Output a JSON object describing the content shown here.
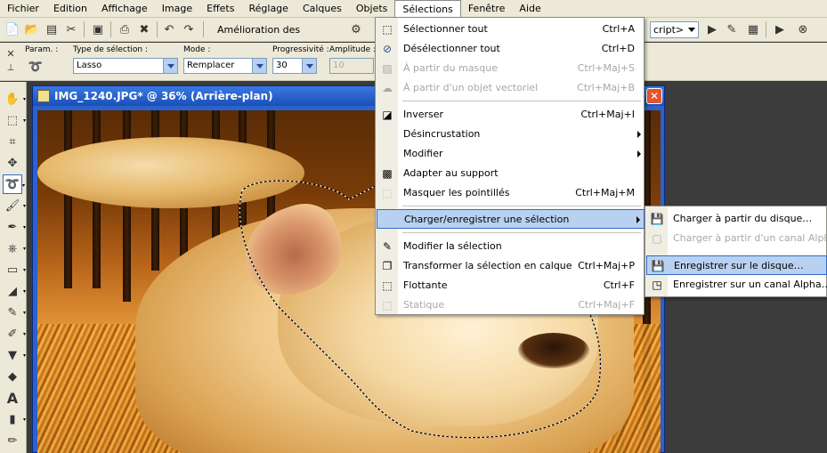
{
  "menubar": {
    "items": [
      "Fichier",
      "Edition",
      "Affichage",
      "Image",
      "Effets",
      "Réglage",
      "Calques",
      "Objets",
      "Sélections",
      "Fenêtre",
      "Aide"
    ],
    "active_index": 8
  },
  "toolbar": {
    "enhance_label": "Amélioration des photos",
    "script_value": "cript>"
  },
  "options": {
    "preset_label": "Param. :",
    "selection_type_label": "Type de sélection :",
    "selection_type_value": "Lasso",
    "mode_label": "Mode :",
    "mode_value": "Remplacer",
    "feather_label": "Progressivité :",
    "feather_value": "30",
    "amplitude_label": "Amplitude :",
    "amplitude_value": "10"
  },
  "document": {
    "title": "IMG_1240.JPG* @  36% (Arrière-plan)",
    "close_label": "✕"
  },
  "selection_menu": {
    "items": [
      {
        "label": "Sélectionner tout",
        "shortcut": "Ctrl+A",
        "disabled": false,
        "icon": "select-all-icon"
      },
      {
        "label": "Désélectionner tout",
        "shortcut": "Ctrl+D",
        "disabled": false,
        "icon": "deselect-icon"
      },
      {
        "label": "À partir du masque",
        "shortcut": "Ctrl+Maj+S",
        "disabled": true,
        "icon": "from-mask-icon"
      },
      {
        "label": "À partir d'un objet vectoriel",
        "shortcut": "Ctrl+Maj+B",
        "disabled": true,
        "icon": "from-vector-icon"
      },
      {
        "label": "Inverser",
        "shortcut": "Ctrl+Maj+I",
        "disabled": false,
        "icon": "invert-icon"
      },
      {
        "label": "Désincrustation",
        "shortcut": "",
        "disabled": false,
        "submenu": true
      },
      {
        "label": "Modifier",
        "shortcut": "",
        "disabled": false,
        "submenu": true
      },
      {
        "label": "Adapter au support",
        "shortcut": "",
        "disabled": false,
        "icon": "fit-canvas-icon"
      },
      {
        "label": "Masquer les pointillés",
        "shortcut": "Ctrl+Maj+M",
        "disabled": false,
        "icon": "hide-marquee-icon"
      },
      {
        "label": "Charger/enregistrer une sélection",
        "shortcut": "",
        "disabled": false,
        "submenu": true,
        "highlighted": true
      },
      {
        "label": "Modifier la sélection",
        "shortcut": "",
        "disabled": false,
        "icon": "edit-selection-icon"
      },
      {
        "label": "Transformer la sélection en calque",
        "shortcut": "Ctrl+Maj+P",
        "disabled": false,
        "icon": "promote-layer-icon"
      },
      {
        "label": "Flottante",
        "shortcut": "Ctrl+F",
        "disabled": false,
        "icon": "float-icon"
      },
      {
        "label": "Statique",
        "shortcut": "Ctrl+Maj+F",
        "disabled": true,
        "icon": "defloat-icon"
      }
    ]
  },
  "load_save_submenu": {
    "items": [
      {
        "label": "Charger à partir du disque…",
        "disabled": false,
        "icon": "load-disk-icon"
      },
      {
        "label": "Charger à partir d'un canal Alpha…",
        "disabled": true,
        "icon": "load-alpha-icon"
      },
      {
        "label": "Enregistrer sur le disque…",
        "disabled": false,
        "highlighted": true,
        "icon": "save-disk-icon"
      },
      {
        "label": "Enregistrer sur un canal Alpha…",
        "disabled": false,
        "icon": "save-alpha-icon"
      }
    ]
  },
  "colors": {
    "menu_highlight": "#b9d1f0",
    "title_bar": "#2c62c9",
    "ui_face": "#ece9d8"
  }
}
